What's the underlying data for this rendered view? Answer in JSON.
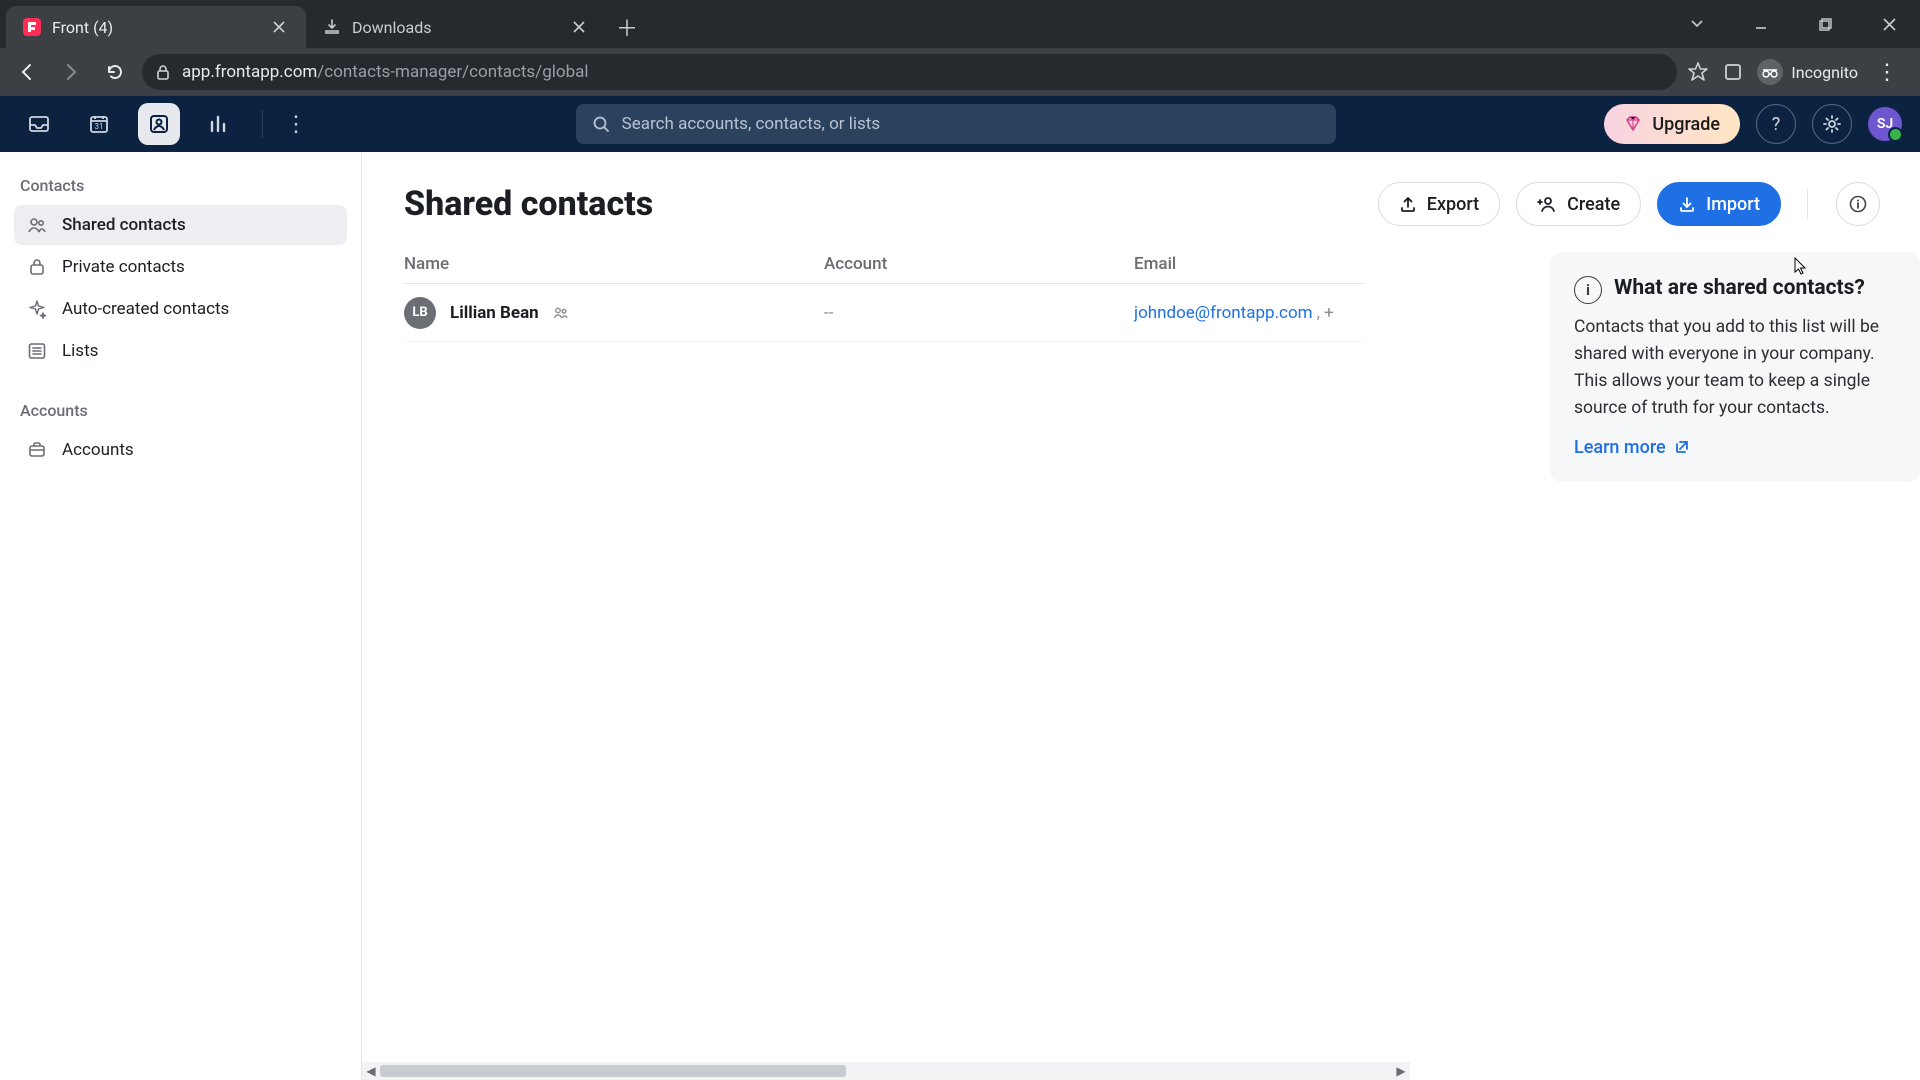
{
  "browser": {
    "tabs": [
      {
        "title": "Front (4)",
        "active": true
      },
      {
        "title": "Downloads",
        "active": false
      }
    ],
    "url_host": "app.frontapp.com",
    "url_path": "/contacts-manager/contacts/global",
    "incognito_label": "Incognito"
  },
  "app_header": {
    "search_placeholder": "Search accounts, contacts, or lists",
    "upgrade": "Upgrade",
    "avatar_initials": "SJ"
  },
  "sidebar": {
    "contacts_label": "Contacts",
    "items": [
      {
        "label": "Shared contacts",
        "active": true
      },
      {
        "label": "Private contacts",
        "active": false
      },
      {
        "label": "Auto-created contacts",
        "active": false
      },
      {
        "label": "Lists",
        "active": false
      }
    ],
    "accounts_label": "Accounts",
    "accounts_item": "Accounts"
  },
  "main": {
    "title": "Shared contacts",
    "actions": {
      "export": "Export",
      "create": "Create",
      "import": "Import"
    },
    "columns": {
      "name": "Name",
      "account": "Account",
      "email": "Email"
    },
    "rows": [
      {
        "initials": "LB",
        "name": "Lillian Bean",
        "account": "--",
        "email": "johndoe@frontapp.com",
        "email_more": ", +"
      }
    ]
  },
  "info_card": {
    "title": "What are shared contacts?",
    "body": "Contacts that you add to this list will be shared with everyone in your company. This allows your team to keep a single source of truth for your contacts.",
    "link": "Learn more"
  }
}
